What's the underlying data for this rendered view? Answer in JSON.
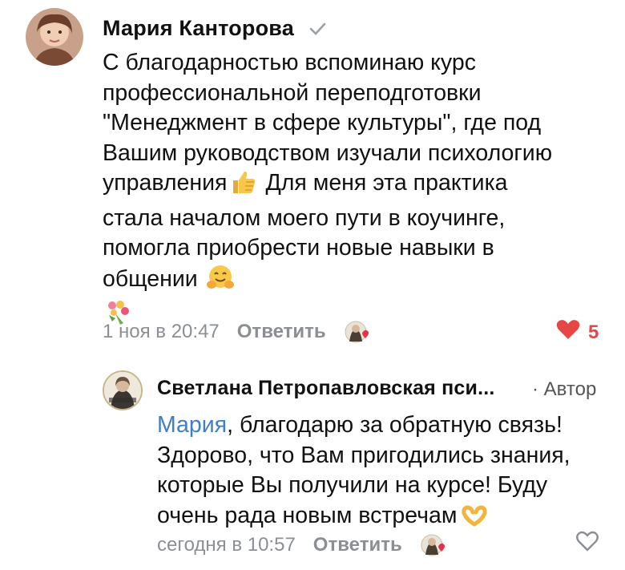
{
  "comment1": {
    "author": "Мария Канторова",
    "lines": [
      "С благодарностью вспоминаю курс",
      "профессиональной переподготовки",
      "\"Менеджмент в сфере культуры\", где под",
      "Вашим руководством изучали психологию",
      "управления",
      "Для меня эта практика",
      "стала началом моего пути в коучинге,",
      "помогла приобрести новые навыки в",
      "общении"
    ],
    "timestamp": "1 ноя в 20:47",
    "reply_label": "Ответить",
    "like_count": "5"
  },
  "comment2": {
    "author": "Светлана Петропавловская пси...",
    "author_tag": "· Автор",
    "mention": "Мария",
    "lines": [
      ", благодарю за обратную связь!",
      "Здорово, что Вам пригодились знания,",
      "которые Вы получили на курсе! Буду",
      "очень рада новым встречам"
    ],
    "timestamp": "сегодня в 10:57",
    "reply_label": "Ответить"
  },
  "colors": {
    "accent_like": "#e64646",
    "meta_gray": "#8b8f94",
    "mention_blue": "#3f7ec9"
  },
  "icons": [
    "verified-check-icon",
    "thumbs-up-emoji",
    "hugging-face-emoji",
    "bouquet-emoji",
    "heart-filled-icon",
    "heart-outline-icon",
    "heart-hands-emoji"
  ]
}
